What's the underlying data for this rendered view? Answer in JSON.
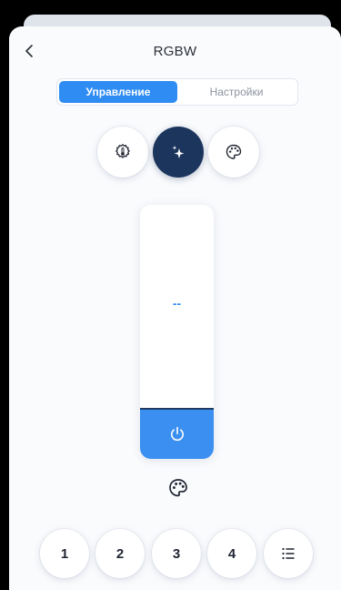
{
  "header": {
    "title": "RGBW",
    "back_icon": "chevron-left-icon"
  },
  "tabs": [
    {
      "label": "Управление",
      "active": true
    },
    {
      "label": "Настройки",
      "active": false
    }
  ],
  "modes": [
    {
      "icon": "temperature-icon",
      "active": false
    },
    {
      "icon": "sparkle-icon",
      "active": true
    },
    {
      "icon": "palette-icon",
      "active": false
    }
  ],
  "slider": {
    "value": "--",
    "fill_fraction": 0.2,
    "power_icon": "power-icon"
  },
  "color_icon": "palette-icon",
  "presets": [
    {
      "label": "1"
    },
    {
      "label": "2"
    },
    {
      "label": "3"
    },
    {
      "label": "4"
    },
    {
      "icon": "list-icon"
    }
  ],
  "colors": {
    "accent": "#2f8cf3",
    "dark": "#1c355c",
    "fill": "#3b8ff0"
  }
}
